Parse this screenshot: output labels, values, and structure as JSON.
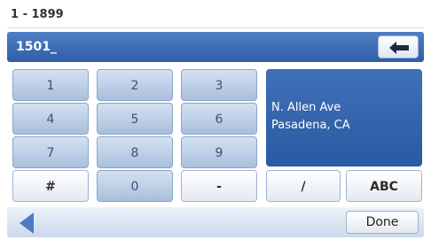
{
  "range": {
    "text": "1 - 1899"
  },
  "entry": {
    "value": "1501_"
  },
  "keys": {
    "k1": "1",
    "k2": "2",
    "k3": "3",
    "k4": "4",
    "k5": "5",
    "k6": "6",
    "k7": "7",
    "k8": "8",
    "k9": "9",
    "hash": "#",
    "k0": "0",
    "dash": "-",
    "slash": "/",
    "abc": "ABC"
  },
  "result": {
    "line1": "N. Allen Ave",
    "line2": "Pasadena, CA"
  },
  "footer": {
    "done": "Done"
  },
  "icons": {
    "backspace": "left-arrow-icon",
    "back": "back-triangle-icon"
  }
}
